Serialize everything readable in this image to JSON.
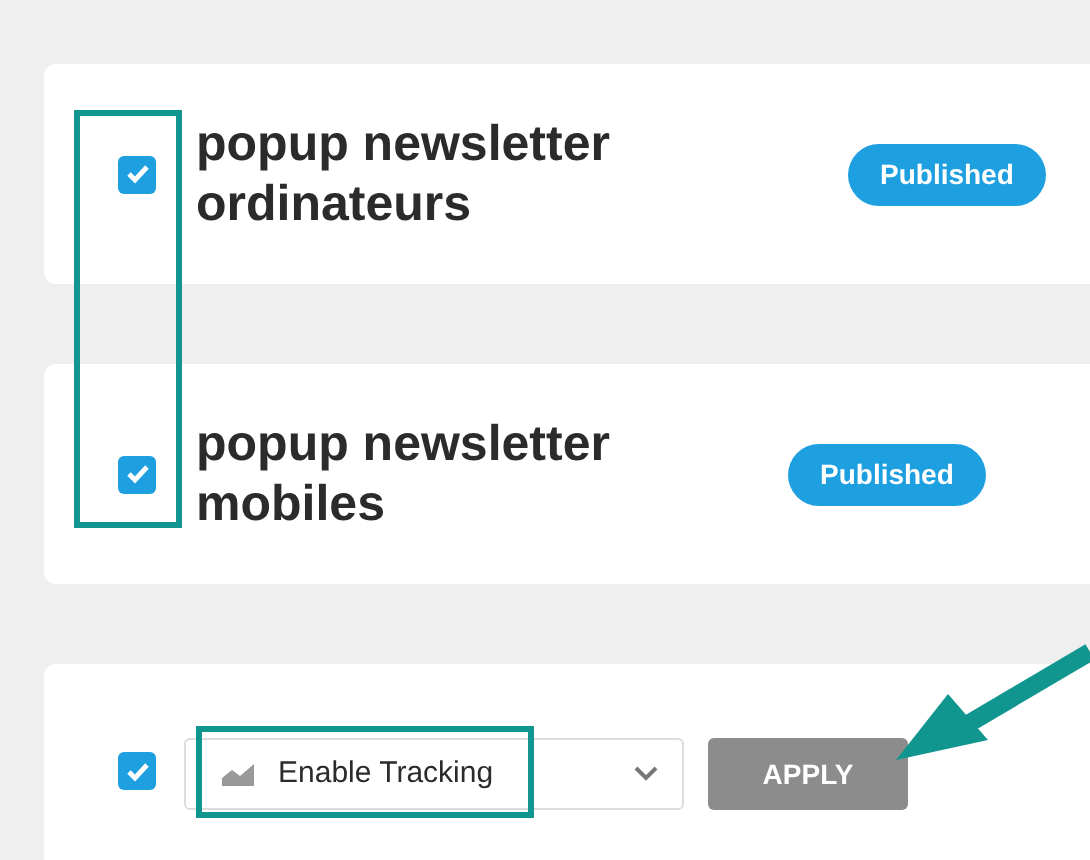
{
  "items": [
    {
      "title": "popup newsletter ordinateurs",
      "checked": true,
      "status": "Published"
    },
    {
      "title": "popup newsletter mobiles",
      "checked": true,
      "status": "Published"
    }
  ],
  "bulk_actions": {
    "checked": true,
    "action": "Enable Tracking",
    "button": "APPLY"
  }
}
